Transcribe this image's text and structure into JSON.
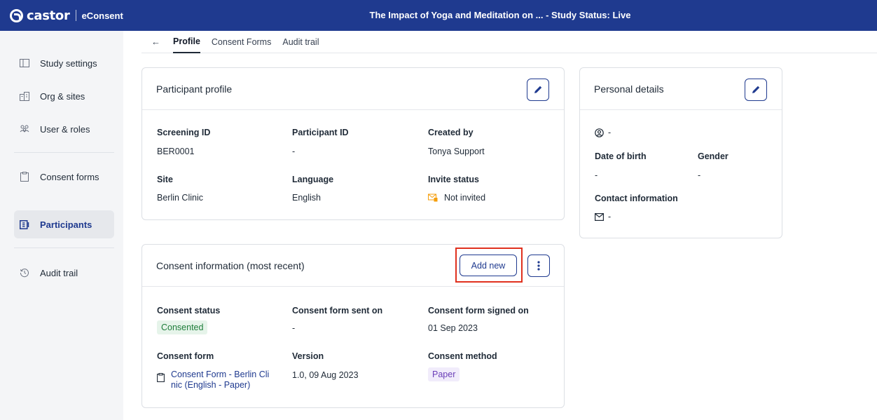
{
  "topbar": {
    "logo_text": "castor",
    "product": "eConsent",
    "study_title": "The Impact of Yoga and Meditation on ...  - Study Status: Live"
  },
  "sidebar": {
    "items": [
      {
        "label": "Study settings",
        "icon": "study-settings-icon"
      },
      {
        "label": "Org & sites",
        "icon": "building-icon"
      },
      {
        "label": "User & roles",
        "icon": "users-icon"
      },
      {
        "label": "Consent forms",
        "icon": "clipboard-icon"
      },
      {
        "label": "Participants",
        "icon": "participants-icon",
        "active": true
      },
      {
        "label": "Audit trail",
        "icon": "history-icon"
      }
    ]
  },
  "tabs": {
    "back": "←",
    "items": [
      "Profile",
      "Consent Forms",
      "Audit trail"
    ],
    "active": "Profile"
  },
  "participant_profile": {
    "title": "Participant profile",
    "fields": {
      "screening_id": {
        "label": "Screening ID",
        "value": "BER0001"
      },
      "participant_id": {
        "label": "Participant ID",
        "value": "-"
      },
      "created_by": {
        "label": "Created by",
        "value": "Tonya Support"
      },
      "site": {
        "label": "Site",
        "value": "Berlin Clinic"
      },
      "language": {
        "label": "Language",
        "value": "English"
      },
      "invite_status": {
        "label": "Invite status",
        "value": "Not invited"
      }
    }
  },
  "personal_details": {
    "title": "Personal details",
    "name_value": "-",
    "dob": {
      "label": "Date of birth",
      "value": "-"
    },
    "gender": {
      "label": "Gender",
      "value": "-"
    },
    "contact": {
      "label": "Contact information",
      "email_value": "-"
    }
  },
  "consent_info": {
    "title": "Consent information (most recent)",
    "add_new_label": "Add new",
    "fields": {
      "status": {
        "label": "Consent status",
        "value": "Consented"
      },
      "sent_on": {
        "label": "Consent form sent on",
        "value": "-"
      },
      "signed_on": {
        "label": "Consent form signed on",
        "value": "01 Sep 2023"
      },
      "form": {
        "label": "Consent form",
        "value_line1": "Consent Form - Berlin Cli",
        "value_line2": "nic (English - Paper)"
      },
      "version": {
        "label": "Version",
        "value": "1.0, 09 Aug 2023"
      },
      "method": {
        "label": "Consent method",
        "value": "Paper"
      }
    }
  },
  "colors": {
    "brand": "#1f3a8f",
    "highlight": "#e0301e",
    "consented_bg": "#e6f4ea",
    "paper_bg": "#f1ecfb"
  }
}
